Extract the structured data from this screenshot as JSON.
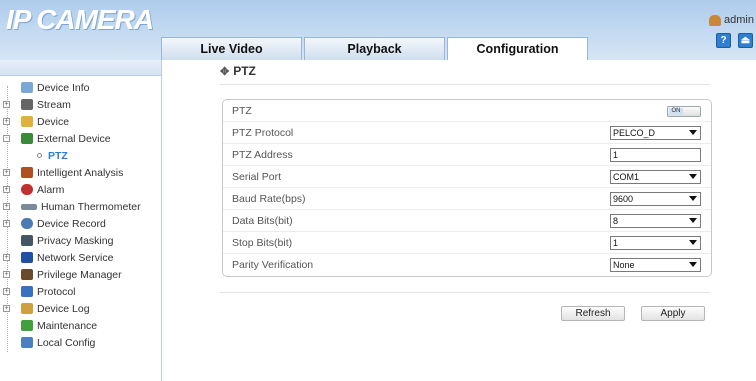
{
  "header": {
    "logo": "IP CAMERA",
    "user": "admin",
    "tabs": [
      "Live Video",
      "Playback",
      "Configuration"
    ],
    "active_tab": "Configuration",
    "help_glyph": "?",
    "logout_glyph": "⏏"
  },
  "sidebar": {
    "items": [
      {
        "label": "Device Info",
        "icon": "device-info-icon",
        "color": "#7ba7d6"
      },
      {
        "label": "Stream",
        "icon": "stream-icon",
        "color": "#666666"
      },
      {
        "label": "Device",
        "icon": "device-icon",
        "color": "#e0b040"
      },
      {
        "label": "External Device",
        "icon": "external-device-icon",
        "color": "#3a8a3a"
      },
      {
        "label": "PTZ",
        "icon": "ptz-sub-icon",
        "color": "#2a7fd4"
      },
      {
        "label": "Intelligent Analysis",
        "icon": "analysis-icon",
        "color": "#b05020"
      },
      {
        "label": "Alarm",
        "icon": "alarm-icon",
        "color": "#c03030"
      },
      {
        "label": "Human Thermometer",
        "icon": "thermometer-icon",
        "color": "#7a8a9a"
      },
      {
        "label": "Device Record",
        "icon": "record-icon",
        "color": "#4a7ab0"
      },
      {
        "label": "Privacy Masking",
        "icon": "privacy-icon",
        "color": "#445566"
      },
      {
        "label": "Network Service",
        "icon": "network-icon",
        "color": "#2050a0"
      },
      {
        "label": "Privilege Manager",
        "icon": "privilege-icon",
        "color": "#6a4a2a"
      },
      {
        "label": "Protocol",
        "icon": "protocol-icon",
        "color": "#3a70c0"
      },
      {
        "label": "Device Log",
        "icon": "log-icon",
        "color": "#d0a040"
      },
      {
        "label": "Maintenance",
        "icon": "maintenance-icon",
        "color": "#40a040"
      },
      {
        "label": "Local Config",
        "icon": "local-config-icon",
        "color": "#4a80c0"
      }
    ]
  },
  "page": {
    "title": "PTZ",
    "toggle_text": "ON",
    "rows": [
      {
        "label": "PTZ"
      },
      {
        "label": "PTZ Protocol",
        "value": "PELCO_D"
      },
      {
        "label": "PTZ Address",
        "value": "1"
      },
      {
        "label": "Serial Port",
        "value": "COM1"
      },
      {
        "label": "Baud Rate(bps)",
        "value": "9600"
      },
      {
        "label": "Data Bits(bit)",
        "value": "8"
      },
      {
        "label": "Stop Bits(bit)",
        "value": "1"
      },
      {
        "label": "Parity Verification",
        "value": "None"
      }
    ],
    "refresh_label": "Refresh",
    "apply_label": "Apply"
  }
}
